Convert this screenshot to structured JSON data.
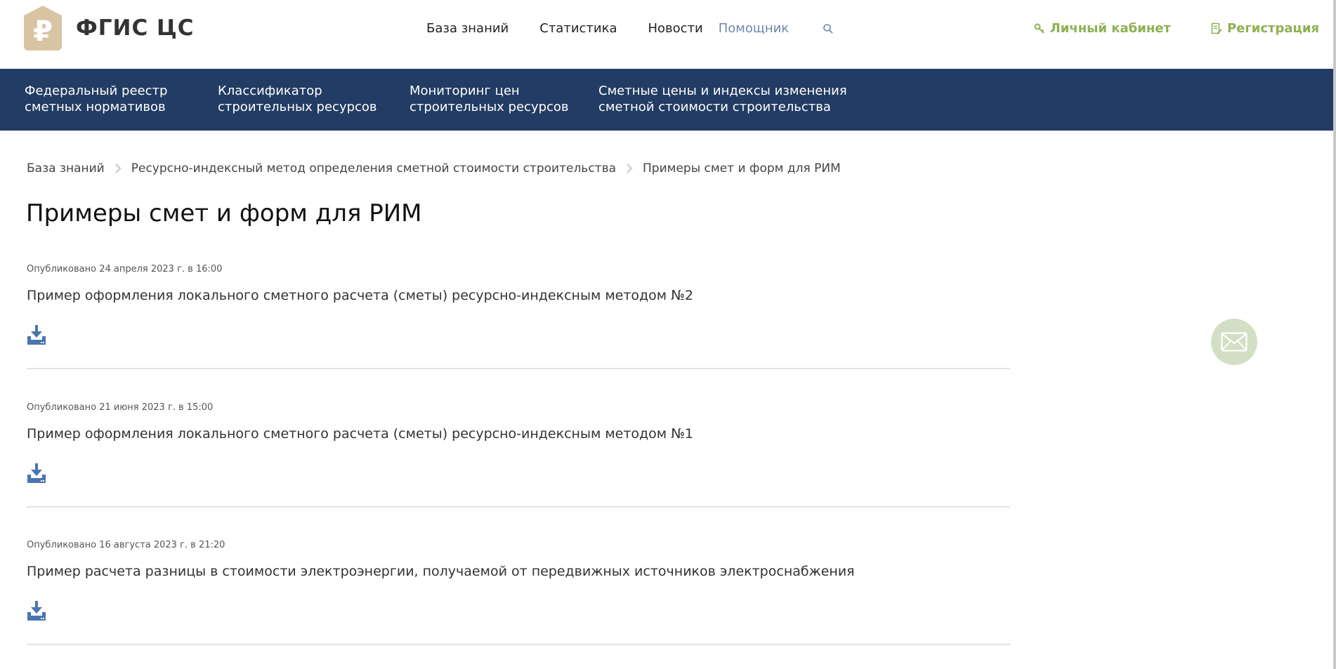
{
  "header": {
    "logo_symbol": "₽",
    "logo_text": "ФГИС ЦС",
    "nav": [
      {
        "label": "База знаний"
      },
      {
        "label": "Статистика"
      },
      {
        "label": "Новости"
      },
      {
        "label": "Помощник"
      }
    ],
    "cabinet_label": "Личный кабинет",
    "register_label": "Регистрация"
  },
  "band": [
    {
      "line1": "Федеральный реестр",
      "line2": "сметных нормативов"
    },
    {
      "line1": "Классификатор",
      "line2": "строительных ресурсов"
    },
    {
      "line1": "Мониторинг цен",
      "line2": "строительных ресурсов"
    },
    {
      "line1": "Сметные цены и индексы изменения",
      "line2": "сметной стоимости строительства"
    }
  ],
  "breadcrumb": [
    "База знаний",
    "Ресурсно-индексный метод определения сметной стоимости строительства",
    "Примеры смет и форм для РИМ"
  ],
  "page_title": "Примеры смет и форм для РИМ",
  "documents": [
    {
      "date": "Опубликовано 24 апреля 2023 г. в 16:00",
      "title": "Пример оформления локального сметного расчета (сметы) ресурсно-индексным методом №2"
    },
    {
      "date": "Опубликовано 21 июня 2023 г. в 15:00",
      "title": "Пример оформления локального сметного расчета (сметы) ресурсно-индексным методом №1"
    },
    {
      "date": "Опубликовано 16 августа 2023 г. в 21:20",
      "title": "Пример расчета разницы в стоимости электроэнергии, получаемой от передвижных источников электроснабжения"
    }
  ],
  "colors": {
    "band": "#223c63",
    "accent_green": "#8db153",
    "icon_blue": "#4a76b0",
    "active_nav": "#6d87b0"
  },
  "icons": {
    "search": "search-icon",
    "download": "download-icon",
    "mail": "mail-icon",
    "cabinet": "key-icon",
    "register": "document-edit-icon"
  }
}
